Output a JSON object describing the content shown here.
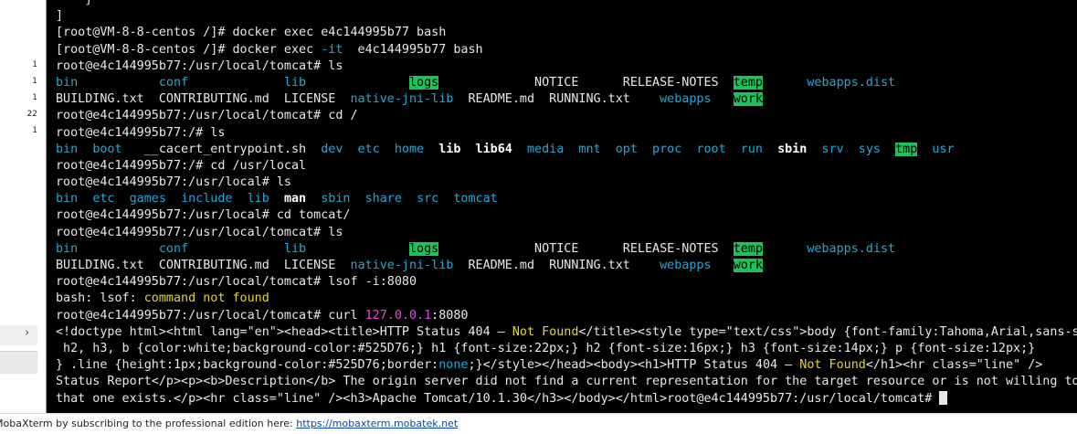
{
  "side_panel": {
    "line_counts": [
      "1",
      "1",
      "1",
      "22",
      "1"
    ],
    "expand_icon": "chevron-right-icon"
  },
  "terminal": {
    "colors": {
      "default": "#e8e8e8",
      "blue": "#22a8d8",
      "highlight": "#1fc25a",
      "yellow": "#e5d435",
      "magenta": "#e14adb"
    },
    "lines": [
      [
        [
          "",
          "    }"
        ]
      ],
      [
        [
          "",
          "]"
        ]
      ],
      [
        [
          "",
          "[root@VM-8-8-centos /]# docker exec e4c144995b77 bash"
        ]
      ],
      [
        [
          "",
          "[root@VM-8-8-centos /]# docker exec "
        ],
        [
          "bl",
          "-it"
        ],
        [
          "",
          "  e4c144995b77 bash"
        ]
      ],
      [
        [
          "",
          "root@e4c144995b77:/usr/local/tomcat# ls"
        ]
      ],
      [
        [
          "bl",
          "bin"
        ],
        [
          "",
          "           "
        ],
        [
          "bl",
          "conf"
        ],
        [
          "",
          "             "
        ],
        [
          "bl",
          "lib"
        ],
        [
          "",
          "              "
        ],
        [
          "hl",
          "logs"
        ],
        [
          "",
          "             NOTICE      RELEASE-NOTES  "
        ],
        [
          "hl",
          "temp"
        ],
        [
          "",
          "      "
        ],
        [
          "bl",
          "webapps.dist"
        ]
      ],
      [
        [
          "",
          "BUILDING.txt  CONTRIBUTING.md  LICENSE  "
        ],
        [
          "bl",
          "native-jni-lib"
        ],
        [
          "",
          "  README.md  RUNNING.txt    "
        ],
        [
          "bl",
          "webapps"
        ],
        [
          "",
          "   "
        ],
        [
          "hl",
          "work"
        ]
      ],
      [
        [
          "",
          "root@e4c144995b77:/usr/local/tomcat# cd /"
        ]
      ],
      [
        [
          "",
          "root@e4c144995b77:/# ls"
        ]
      ],
      [
        [
          "bl",
          "bin"
        ],
        [
          "",
          "  "
        ],
        [
          "bl",
          "boot"
        ],
        [
          "",
          "   __cacert_entrypoint.sh  "
        ],
        [
          "bl",
          "dev"
        ],
        [
          "",
          "  "
        ],
        [
          "bl",
          "etc"
        ],
        [
          "",
          "  "
        ],
        [
          "bl",
          "home"
        ],
        [
          "",
          "  "
        ],
        [
          "bd",
          "lib"
        ],
        [
          "",
          "  "
        ],
        [
          "bd",
          "lib64"
        ],
        [
          "",
          "  "
        ],
        [
          "bl",
          "media"
        ],
        [
          "",
          "  "
        ],
        [
          "bl",
          "mnt"
        ],
        [
          "",
          "  "
        ],
        [
          "bl",
          "opt"
        ],
        [
          "",
          "  "
        ],
        [
          "bl",
          "proc"
        ],
        [
          "",
          "  "
        ],
        [
          "bl",
          "root"
        ],
        [
          "",
          "  "
        ],
        [
          "bl",
          "run"
        ],
        [
          "",
          "  "
        ],
        [
          "bd",
          "sbin"
        ],
        [
          "",
          "  "
        ],
        [
          "bl",
          "srv"
        ],
        [
          "",
          "  "
        ],
        [
          "bl",
          "sys"
        ],
        [
          "",
          "  "
        ],
        [
          "hl",
          "tmp"
        ],
        [
          "",
          "  "
        ],
        [
          "bl",
          "usr"
        ]
      ],
      [
        [
          "",
          "root@e4c144995b77:/# cd /usr/local"
        ]
      ],
      [
        [
          "",
          "root@e4c144995b77:/usr/local# ls"
        ]
      ],
      [
        [
          "bl",
          "bin"
        ],
        [
          "",
          "  "
        ],
        [
          "bl",
          "etc"
        ],
        [
          "",
          "  "
        ],
        [
          "bl",
          "games"
        ],
        [
          "",
          "  "
        ],
        [
          "bl",
          "include"
        ],
        [
          "",
          "  "
        ],
        [
          "bl",
          "lib"
        ],
        [
          "",
          "  "
        ],
        [
          "bd",
          "man"
        ],
        [
          "",
          "  "
        ],
        [
          "bl",
          "sbin"
        ],
        [
          "",
          "  "
        ],
        [
          "bl",
          "share"
        ],
        [
          "",
          "  "
        ],
        [
          "bl",
          "src"
        ],
        [
          "",
          "  "
        ],
        [
          "bl",
          "tomcat"
        ]
      ],
      [
        [
          "",
          "root@e4c144995b77:/usr/local# cd tomcat/"
        ]
      ],
      [
        [
          "",
          "root@e4c144995b77:/usr/local/tomcat# ls"
        ]
      ],
      [
        [
          "bl",
          "bin"
        ],
        [
          "",
          "           "
        ],
        [
          "bl",
          "conf"
        ],
        [
          "",
          "             "
        ],
        [
          "bl",
          "lib"
        ],
        [
          "",
          "              "
        ],
        [
          "hl",
          "logs"
        ],
        [
          "",
          "             NOTICE      RELEASE-NOTES  "
        ],
        [
          "hl",
          "temp"
        ],
        [
          "",
          "      "
        ],
        [
          "bl",
          "webapps.dist"
        ]
      ],
      [
        [
          "",
          "BUILDING.txt  CONTRIBUTING.md  LICENSE  "
        ],
        [
          "bl",
          "native-jni-lib"
        ],
        [
          "",
          "  README.md  RUNNING.txt    "
        ],
        [
          "bl",
          "webapps"
        ],
        [
          "",
          "   "
        ],
        [
          "hl",
          "work"
        ]
      ],
      [
        [
          "",
          "root@e4c144995b77:/usr/local/tomcat# lsof -i:8080"
        ]
      ],
      [
        [
          "",
          "bash: lsof: "
        ],
        [
          "yl",
          "command not found"
        ]
      ],
      [
        [
          "",
          "root@e4c144995b77:/usr/local/tomcat# curl "
        ],
        [
          "mg",
          "127.0.0.1"
        ],
        [
          "",
          ":8080"
        ]
      ],
      [
        [
          "",
          "<!doctype html><html lang=\"en\"><head><title>HTTP Status 404 – "
        ],
        [
          "yl",
          "Not Found"
        ],
        [
          "",
          "</title><style type=\"text/css\">body {font-family:Tahoma,Arial,sans-serif;}"
        ]
      ],
      [
        [
          "",
          " h2, h3, b {color:white;background-color:#525D76;} h1 {font-size:22px;} h2 {font-size:16px;} h3 {font-size:14px;} p {font-size:12px;}"
        ]
      ],
      [
        [
          "",
          "} .line {height:1px;background-color:#525D76;border:"
        ],
        [
          "bl",
          "none"
        ],
        [
          "",
          ";}</style></head><body><h1>HTTP Status 404 – "
        ],
        [
          "yl",
          "Not Found"
        ],
        [
          "",
          "</h1><hr class=\"line\" />"
        ]
      ],
      [
        [
          "",
          "Status Report</p><p><b>Description</b> The origin server did not find a current representation for the target resource or is not willing to disclose"
        ]
      ],
      [
        [
          "",
          "that one exists.</p><hr class=\"line\" /><h3>Apache Tomcat/10.1.30</h3></body></html>root@e4c144995b77:/usr/local/tomcat# "
        ],
        [
          "cursor",
          ""
        ]
      ]
    ]
  },
  "status_bar": {
    "text": "MobaXterm by subscribing to the professional edition here:  ",
    "link": "https://mobaxterm.mobatek.net"
  }
}
